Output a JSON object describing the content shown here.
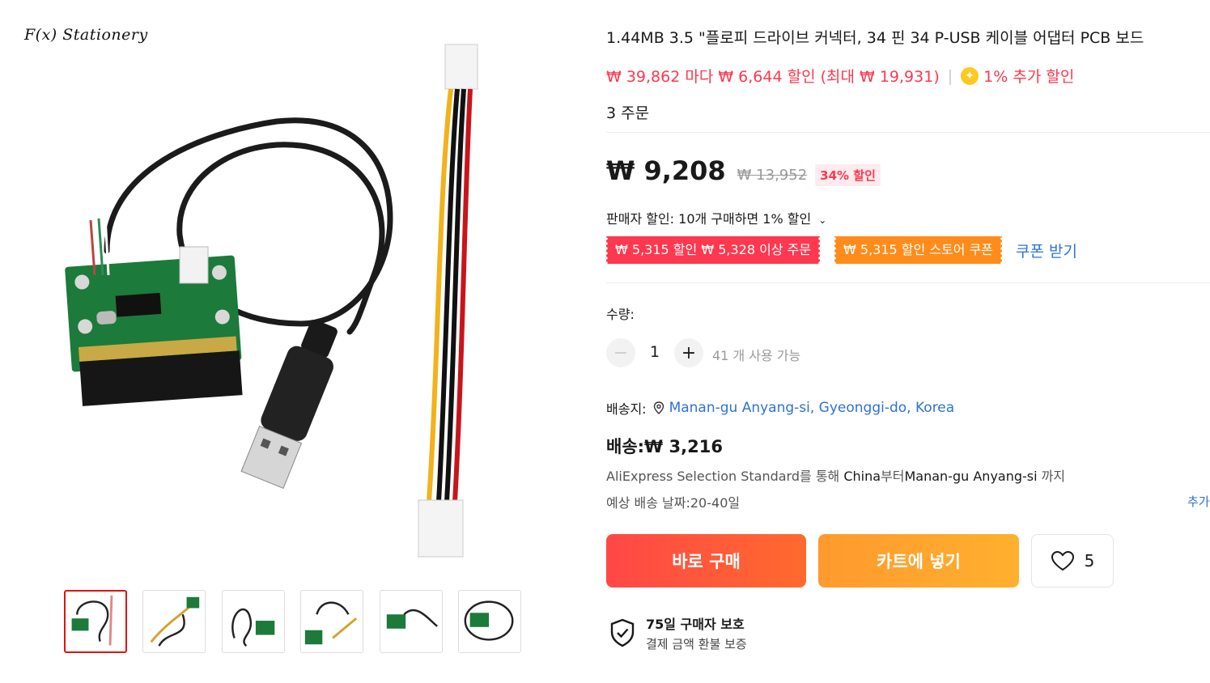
{
  "brand": "F(x) Stationery",
  "product": {
    "title": "1.44MB 3.5 \"플로피 드라이브 커넥터, 34 핀 34 P-USB 케이블 어댑터 PCB 보드",
    "promo_text": "₩ 39,862 마다 ₩ 6,644 할인 (최대 ₩ 19,931)",
    "promo_separator": "|",
    "extra_discount": "1% 추가 할인",
    "orders": "3 주문",
    "price": "₩ 9,208",
    "old_price": "₩ 13,952",
    "discount_badge": "34% 할인",
    "seller_discount": "판매자 할인: 10개 구매하면 1% 할인",
    "coupons": [
      "₩ 5,315 할인 ₩ 5,328 이상 주문",
      "₩ 5,315 할인 스토어 쿠폰"
    ],
    "get_coupon": "쿠폰 받기"
  },
  "quantity": {
    "label": "수량:",
    "value": "1",
    "minus": "−",
    "plus": "+",
    "available": "41 개 사용 가능"
  },
  "shipping": {
    "to_label": "배송지:",
    "location": "Manan-gu Anyang-si, Gyeonggi-do, Korea",
    "fee": "배송:₩ 3,216",
    "route_prefix": "AliExpress Selection Standard를 통해 ",
    "route_from": "China",
    "route_mid": "부터",
    "route_to": "Manan-gu Anyang-si",
    "route_suffix": " 까지",
    "eta": "예상 배송 날짜:20-40일",
    "more": "추가"
  },
  "actions": {
    "buy_now": "바로 구매",
    "add_to_cart": "카트에 넣기",
    "wishlist_count": "5"
  },
  "protection": {
    "title": "75일 구매자 보호",
    "subtitle": "결제 금액 환불 보증"
  },
  "icons": {
    "coin": "coin-icon",
    "location": "location-pin-icon",
    "heart": "heart-icon",
    "shield": "shield-check-icon",
    "chevron": "chevron-down-icon"
  },
  "colors": {
    "accent_red": "#fd384f",
    "orange": "#ff8c1a",
    "link_blue": "#2e72d2",
    "active_thumb_border": "#e21212"
  }
}
